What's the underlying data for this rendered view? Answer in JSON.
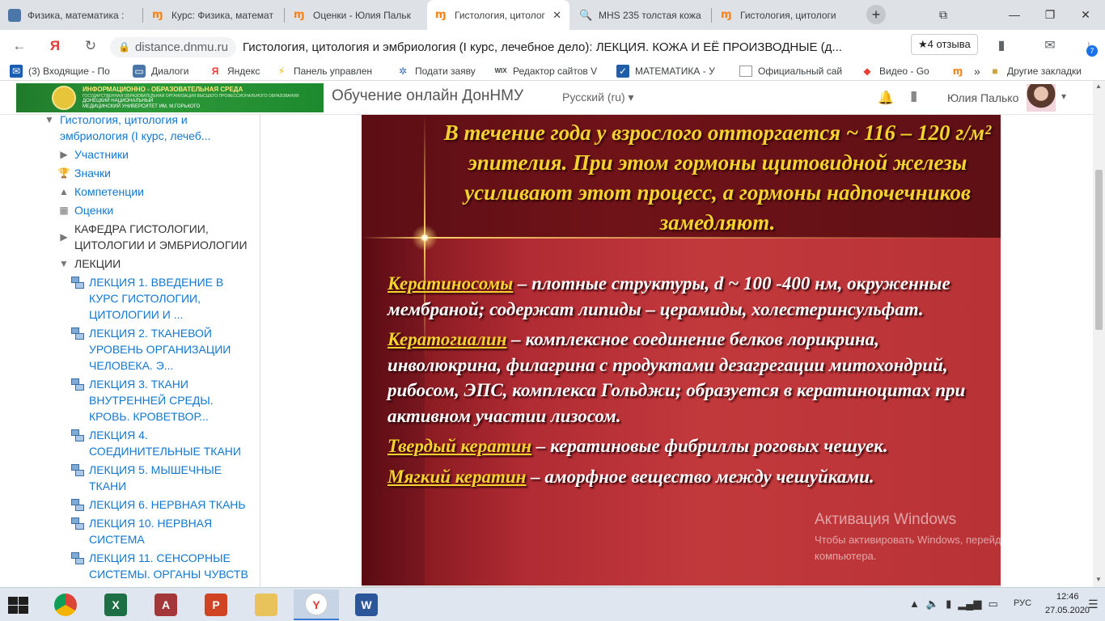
{
  "browser": {
    "tabs": [
      {
        "title": "Физика, математика :",
        "icon": "vk-icon"
      },
      {
        "title": "Курс: Физика, математ",
        "icon": "moodle-icon"
      },
      {
        "title": "Оценки - Юлия Пальк",
        "icon": "moodle-icon"
      },
      {
        "title": "Гистология, цитолог",
        "icon": "moodle-icon",
        "active": true
      },
      {
        "title": "МНS 235 толстая кожа",
        "icon": "search-icon"
      },
      {
        "title": "Гистология, цитологи",
        "icon": "moodle-icon"
      }
    ],
    "tab_close": "✕",
    "new_tab": "+",
    "window_minimize": "—",
    "window_restore": "❐",
    "window_close": "✕"
  },
  "address": {
    "domain": "distance.dnmu.ru",
    "page_title": "Гистология, цитология и эмбриология (I курс, лечебное дело): ЛЕКЦИЯ. КОЖА И ЕЁ ПРОИЗВОДНЫЕ (д...",
    "reviews": "★4 отзыва",
    "yandex_logo": "Я"
  },
  "bookmarks": [
    {
      "label": "(3) Входящие - По",
      "icon": "mail-icon"
    },
    {
      "label": "Диалоги",
      "icon": "chat-icon"
    },
    {
      "label": "Яндекс",
      "icon": "yandex-icon"
    },
    {
      "label": "Панель управлен",
      "icon": "panel-icon"
    },
    {
      "label": "Подати заяву",
      "icon": "emblem-icon"
    },
    {
      "label": "Редактор сайтов V",
      "icon": "wix-icon"
    },
    {
      "label": "МАТЕМАТИКА - У",
      "icon": "math-icon"
    },
    {
      "label": "Официальный сай",
      "icon": "page-icon"
    },
    {
      "label": "Видео - Go",
      "icon": "video-icon"
    },
    {
      "label": "»",
      "icon": ""
    },
    {
      "label": "Другие закладки",
      "icon": "folder-icon"
    }
  ],
  "header": {
    "logo_line1": "ИНФОРМАЦИОННО - ОБРАЗОВАТЕЛЬНАЯ СРЕДА",
    "logo_line2": "ГОСУДАРСТВЕННАЯ ОБРАЗОВАТЕЛЬНАЯ ОРГАНИЗАЦИЯ ВЫСШЕГО ПРОФЕССИОНАЛЬНОГО ОБРАЗОВАНИЯ",
    "logo_line3": "ДОНЕЦКИЙ НАЦИОНАЛЬНЫЙ",
    "logo_line4": "МЕДИЦИНСКИЙ УНИВЕРСИТЕТ ИМ. М.ГОРЬКОГО",
    "site_name": "Обучение онлайн ДонНМУ",
    "language": "Русский (ru) ▾",
    "user_name": "Юлия Палько",
    "user_caret": "▾"
  },
  "sidebar": {
    "course": "Гистология, цитология и эмбриология (I курс, лечеб...",
    "items": [
      {
        "label": "Участники",
        "icon": "caret-right-icon"
      },
      {
        "label": "Значки",
        "icon": "trophy-icon"
      },
      {
        "label": "Компетенции",
        "icon": "competency-icon"
      },
      {
        "label": "Оценки",
        "icon": "table-icon"
      },
      {
        "label": "КАФЕДРА ГИСТОЛОГИИ, ЦИТОЛОГИИ И ЭМБРИОЛОГИИ",
        "icon": "caret-right-icon"
      },
      {
        "label": "ЛЕКЦИИ",
        "icon": "caret-down-icon"
      }
    ],
    "lectures": [
      "ЛЕКЦИЯ 1. ВВЕДЕНИЕ В КУРС ГИСТОЛОГИИ, ЦИТОЛОГИИ И ...",
      "ЛЕКЦИЯ 2. ТКАНЕВОЙ УРОВЕНЬ ОРГАНИЗАЦИИ ЧЕЛОВЕКА. Э...",
      "ЛЕКЦИЯ 3. ТКАНИ ВНУТРЕННЕЙ СРЕДЫ. КРОВЬ. КРОВЕТВОР...",
      "ЛЕКЦИЯ 4. СОЕДИНИТЕЛЬНЫЕ ТКАНИ",
      "ЛЕКЦИЯ 5. МЫШЕЧНЫЕ ТКАНИ",
      "ЛЕКЦИЯ 6. НЕРВНАЯ ТКАНЬ",
      "ЛЕКЦИЯ 10. НЕРВНАЯ СИСТЕМА",
      "ЛЕКЦИЯ 11. СЕНСОРНЫЕ СИСТЕМЫ. ОРГАНЫ ЧУВСТВ"
    ]
  },
  "slide": {
    "heading": "В течение года у взрослого отторгается ~ 116 – 120 г/м² эпителия. При этом гормоны щитовидной железы усиливают этот процесс, а гормоны надпочечников замедляют.",
    "paragraphs": [
      {
        "term": "Кератиносомы",
        "text": " – плотные структуры, d ~ 100 -400 нм, окруженные мембраной; содержат липиды – церамиды, холестеринсульфат."
      },
      {
        "term": "Кератогиалин",
        "text": " – комплексное соединение белков лорикрина, инволюкрина, филагрина с продуктами дезагрегации митохондрий, рибосом, ЭПС, комплекса Гольджи; образуется в кератиноцитах  при активном участии лизосом."
      },
      {
        "term": "Твердый кератин",
        "text": " – кератиновые фибриллы роговых чешуек."
      },
      {
        "term": "Мягкий кератин",
        "text": " – аморфное вещество между чешуйками."
      }
    ]
  },
  "watermark": {
    "title": "Активация Windows",
    "text": "Чтобы активировать Windows, перейдите к параметрам компьютера."
  },
  "taskbar": {
    "apps": [
      {
        "name": "chrome",
        "icon": "chrome-icon"
      },
      {
        "name": "excel",
        "icon": "excel-icon"
      },
      {
        "name": "access",
        "icon": "access-icon"
      },
      {
        "name": "powerpoint",
        "icon": "powerpoint-icon"
      },
      {
        "name": "explorer",
        "icon": "folder-icon"
      },
      {
        "name": "yandex",
        "icon": "yandex-browser-icon"
      },
      {
        "name": "word",
        "icon": "word-icon"
      }
    ],
    "language": "РУС",
    "time": "12:46",
    "date": "27.05.2020"
  }
}
